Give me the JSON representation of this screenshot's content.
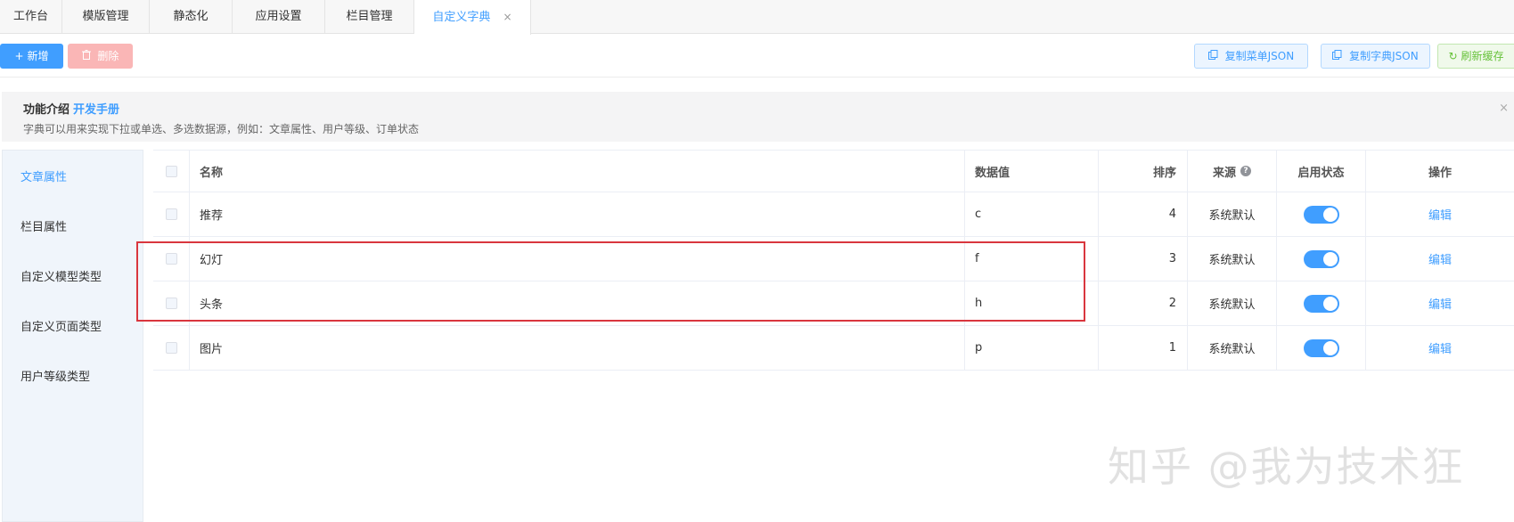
{
  "tabs": [
    {
      "label": "工作台"
    },
    {
      "label": "模版管理"
    },
    {
      "label": "静态化"
    },
    {
      "label": "应用设置"
    },
    {
      "label": "栏目管理"
    },
    {
      "label": "自定义字典",
      "close": "×"
    }
  ],
  "toolbar": {
    "add_label": "新增",
    "add_icon": "+",
    "delete_label": "删除",
    "copy_menu_json_label": "复制菜单JSON",
    "copy_dict_json_label": "复制字典JSON",
    "refresh_cache_label": "刷新缓存"
  },
  "banner": {
    "title": "功能介绍",
    "link": "开发手册",
    "desc": "字典可以用来实现下拉或单选、多选数据源，例如：文章属性、用户等级、订单状态",
    "close": "×"
  },
  "sidebar": {
    "items": [
      {
        "label": "文章属性"
      },
      {
        "label": "栏目属性"
      },
      {
        "label": "自定义模型类型"
      },
      {
        "label": "自定义页面类型"
      },
      {
        "label": "用户等级类型"
      }
    ]
  },
  "table": {
    "columns": {
      "name": "名称",
      "value": "数据值",
      "sort": "排序",
      "source": "来源",
      "status": "启用状态",
      "actions": "操作"
    },
    "rows": [
      {
        "name": "推荐",
        "value": "c",
        "sort": "4",
        "source": "系统默认",
        "enabled": true,
        "action": "编辑"
      },
      {
        "name": "幻灯",
        "value": "f",
        "sort": "3",
        "source": "系统默认",
        "enabled": true,
        "action": "编辑"
      },
      {
        "name": "头条",
        "value": "h",
        "sort": "2",
        "source": "系统默认",
        "enabled": true,
        "action": "编辑"
      },
      {
        "name": "图片",
        "value": "p",
        "sort": "1",
        "source": "系统默认",
        "enabled": true,
        "action": "编辑"
      }
    ]
  },
  "watermark": "知乎 @我为技术狂",
  "colors": {
    "primary": "#409eff",
    "danger_light": "#fab6b6",
    "highlight_box": "#d9363e"
  }
}
